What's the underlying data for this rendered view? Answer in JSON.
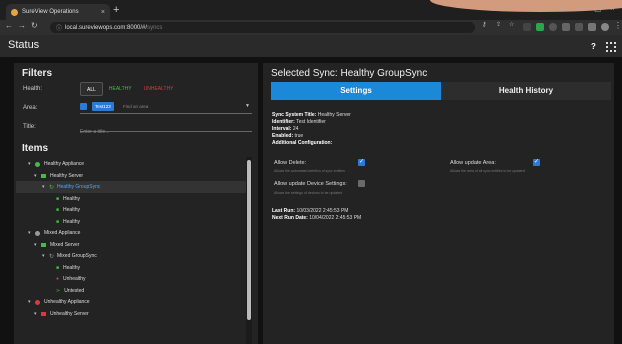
{
  "browser": {
    "tab_title": "SureView Operations",
    "tab_close": "×",
    "new_tab": "+",
    "url_host": "local.sureviewops.com",
    "url_path": ":8000/#/",
    "url_dim": "syncs",
    "window_controls": [
      "∨",
      "–",
      "▢",
      "×"
    ]
  },
  "app": {
    "page_title": "Status",
    "help_label": "?"
  },
  "filters": {
    "heading": "Filters",
    "health_label": "Health:",
    "health_options": [
      "ALL",
      "HEALTHY",
      "UNHEALTHY"
    ],
    "area_label": "Area:",
    "area_chip": "Test123",
    "area_placeholder": "Find an area",
    "title_label": "Title:",
    "title_placeholder": "Enter a title..."
  },
  "items": {
    "heading": "Items",
    "tree": [
      {
        "label": "Healthy Appliance",
        "type": "appliance",
        "status": "healthy"
      },
      {
        "label": "Healthy Server",
        "type": "server",
        "status": "healthy"
      },
      {
        "label": "Healthy GroupSync",
        "type": "sync",
        "status": "healthy",
        "selected": true
      },
      {
        "label": "Healthy",
        "type": "leaf",
        "status": "healthy"
      },
      {
        "label": "Healthy",
        "type": "leaf",
        "status": "healthy"
      },
      {
        "label": "Healthy",
        "type": "leaf",
        "status": "healthy"
      },
      {
        "label": "Mixed Appliance",
        "type": "appliance",
        "status": "mixed"
      },
      {
        "label": "Mixed Server",
        "type": "server",
        "status": "healthy"
      },
      {
        "label": "Mixed GroupSync",
        "type": "sync",
        "status": "mixed"
      },
      {
        "label": "Healthy",
        "type": "leaf",
        "status": "healthy"
      },
      {
        "label": "Unhealthy",
        "type": "leaf",
        "status": "unhealthy"
      },
      {
        "label": "Untested",
        "type": "leaf",
        "status": "untested"
      },
      {
        "label": "Unhealthy Appliance",
        "type": "appliance",
        "status": "unhealthy"
      },
      {
        "label": "Unhealthy Server",
        "type": "server",
        "status": "unhealthy"
      }
    ]
  },
  "selected": {
    "heading": "Selected Sync:",
    "name": "Healthy GroupSync",
    "tabs": [
      "Settings",
      "Health History"
    ],
    "info": {
      "system_title_label": "Sync System Title:",
      "system_title": "Healthy Server",
      "identifier_label": "Identifier:",
      "identifier": "Test Identifier",
      "interval_label": "Interval:",
      "interval": "24",
      "enabled_label": "Enabled:",
      "enabled": "true",
      "additional_label": "Additional Configuration:"
    },
    "options": {
      "allow_delete": {
        "label": "Allow Delete:",
        "help": "Allows the automated deletion of sync entities",
        "checked": true
      },
      "allow_update_area": {
        "label": "Allow update Area:",
        "help": "Allows the area of all sync entities to be updated",
        "checked": true
      },
      "allow_update_device": {
        "label": "Allow update Device Settings:",
        "help": "Allows the settings of devices to be updated",
        "checked": false
      }
    },
    "last_run_label": "Last Run:",
    "last_run": "10/03/2022 2:45:53 PM",
    "next_run_label": "Next Run Date:",
    "next_run": "10/04/2022 2:45:53 PM"
  },
  "colors": {
    "healthy": "#3fbf3f",
    "unhealthy": "#d83b3b",
    "mixed": "#9a9a9a",
    "untested": "#3fbf3f",
    "accent": "#1c89d8"
  }
}
